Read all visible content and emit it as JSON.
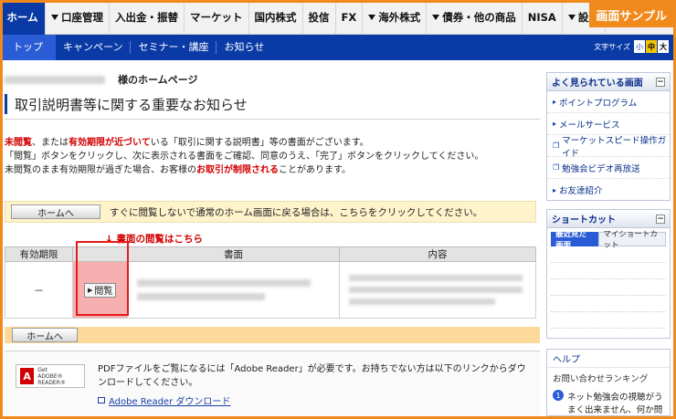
{
  "badge": "画面サンプル",
  "topnav": {
    "items": [
      {
        "label": "ホーム",
        "active": true,
        "dropdown": false
      },
      {
        "label": "口座管理",
        "dropdown": true
      },
      {
        "label": "入出金・振替",
        "dropdown": false
      },
      {
        "label": "マーケット",
        "dropdown": false
      },
      {
        "label": "国内株式",
        "dropdown": false
      },
      {
        "label": "投信",
        "dropdown": false
      },
      {
        "label": "FX",
        "dropdown": false
      },
      {
        "label": "海外株式",
        "dropdown": true
      },
      {
        "label": "債券・他の商品",
        "dropdown": true
      },
      {
        "label": "NISA",
        "dropdown": false
      },
      {
        "label": "設定",
        "dropdown": true
      }
    ]
  },
  "subnav": {
    "items": [
      "トップ",
      "キャンペーン",
      "セミナー・講座",
      "お知らせ"
    ],
    "font_size_label": "文字サイズ",
    "font_sizes": [
      "小",
      "中",
      "大"
    ]
  },
  "main": {
    "account_suffix": "様のホームページ",
    "title": "取引説明書等に関する重要なお知らせ",
    "intro": {
      "p1": "未閲覧",
      "p2": "、または",
      "p3": "有効期限が近づいて",
      "p4": "いる「取引に関する説明書」等の書面がございます。",
      "line2": "「閲覧」ボタンをクリックし、次に表示される書面をご確認、同意のうえ、「完了」ボタンをクリックしてください。",
      "line3a": "未閲覧のまま有効期限が過ぎた場合、お客様の",
      "line3b": "お取引が制限される",
      "line3c": "ことがあります。"
    },
    "home_button": "ホームへ",
    "home_bar_text": "すぐに閲覧しないで通常のホーム画面に戻る場合は、こちらをクリックしてください。",
    "callout": "↓ 書面の閲覧はこちら",
    "table": {
      "headers": [
        "有効期限",
        "",
        "書面",
        "内容"
      ],
      "row": {
        "expiry": "－",
        "view_button": "閲覧"
      }
    },
    "pdf": {
      "adobe_get": "Get",
      "adobe_name": "ADOBE® READER®",
      "text": "PDFファイルをご覧になるには「Adobe Reader」が必要です。お持ちでない方は以下のリンクからダウンロードしてください。",
      "link": "Adobe Reader ダウンロード"
    }
  },
  "sidebar": {
    "popular": {
      "title": "よく見られている画面",
      "items": [
        {
          "label": "ポイントプログラム",
          "icon": "arrow-icon"
        },
        {
          "label": "メールサービス",
          "icon": "arrow-icon"
        },
        {
          "label": "マーケットスピード操作ガイド",
          "icon": "window-icon"
        },
        {
          "label": "勉強会ビデオ再放送",
          "icon": "window-icon"
        },
        {
          "label": "お友達紹介",
          "icon": "arrow-icon"
        }
      ]
    },
    "shortcut": {
      "title": "ショートカット",
      "tabs": [
        "最近見た画面",
        "マイショートカット"
      ]
    },
    "help": {
      "title": "ヘルプ",
      "subtitle": "お問い合わせランキング",
      "item1": "ネット勉強会の視聴がうまく出来ません、何か問題があ"
    }
  },
  "colors": {
    "accent": "#0a3aa6",
    "badge": "#f08a1c",
    "alert": "#d10000",
    "highlight_box": "#e31b1b"
  }
}
